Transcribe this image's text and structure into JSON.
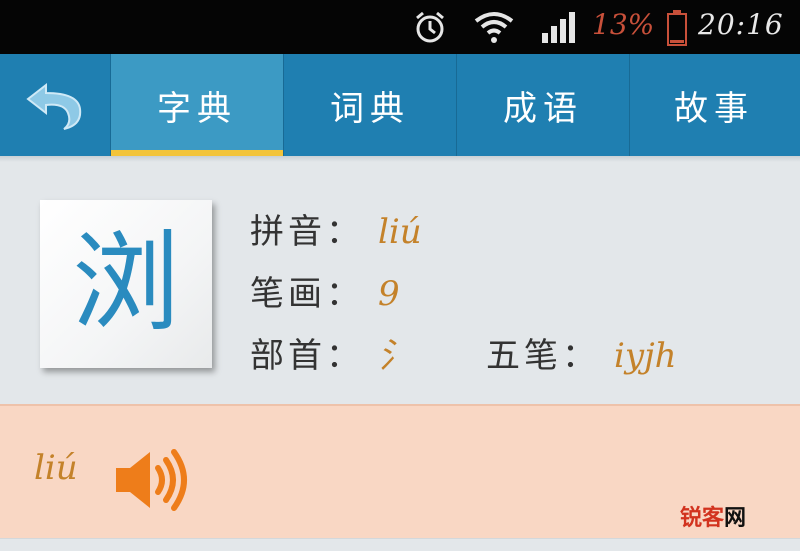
{
  "status_bar": {
    "icons": [
      "alarm-icon",
      "wifi-icon",
      "signal-icon",
      "battery-icon"
    ],
    "battery_percent": "13%",
    "time": "20:16",
    "colors": {
      "background": "#050505",
      "battery_text": "#c8503a"
    }
  },
  "nav": {
    "back_icon": "back-arrow-icon",
    "tabs": [
      {
        "label": "字典",
        "active": true
      },
      {
        "label": "词典",
        "active": false
      },
      {
        "label": "成语",
        "active": false
      },
      {
        "label": "故事",
        "active": false
      }
    ],
    "colors": {
      "bar": "#1f7fb1",
      "active_tab": "#3c9ac4",
      "indicator": "#f2c43b"
    }
  },
  "entry": {
    "character": "浏",
    "pinyin_label": "拼音：",
    "pinyin": "liú",
    "strokes_label": "笔画：",
    "strokes": "9",
    "radical_label": "部首：",
    "radical": "氵",
    "wubi_label": "五笔：",
    "wubi": "iyjh",
    "colors": {
      "character": "#2a8bbf",
      "value": "#c4822a"
    }
  },
  "pronunciation": {
    "pinyin": "liú",
    "speaker_icon": "speaker-icon",
    "colors": {
      "background": "#f9d7c4",
      "speaker": "#ee7d1a"
    }
  },
  "watermark": {
    "brand": "锐客",
    "suffix": "网"
  }
}
